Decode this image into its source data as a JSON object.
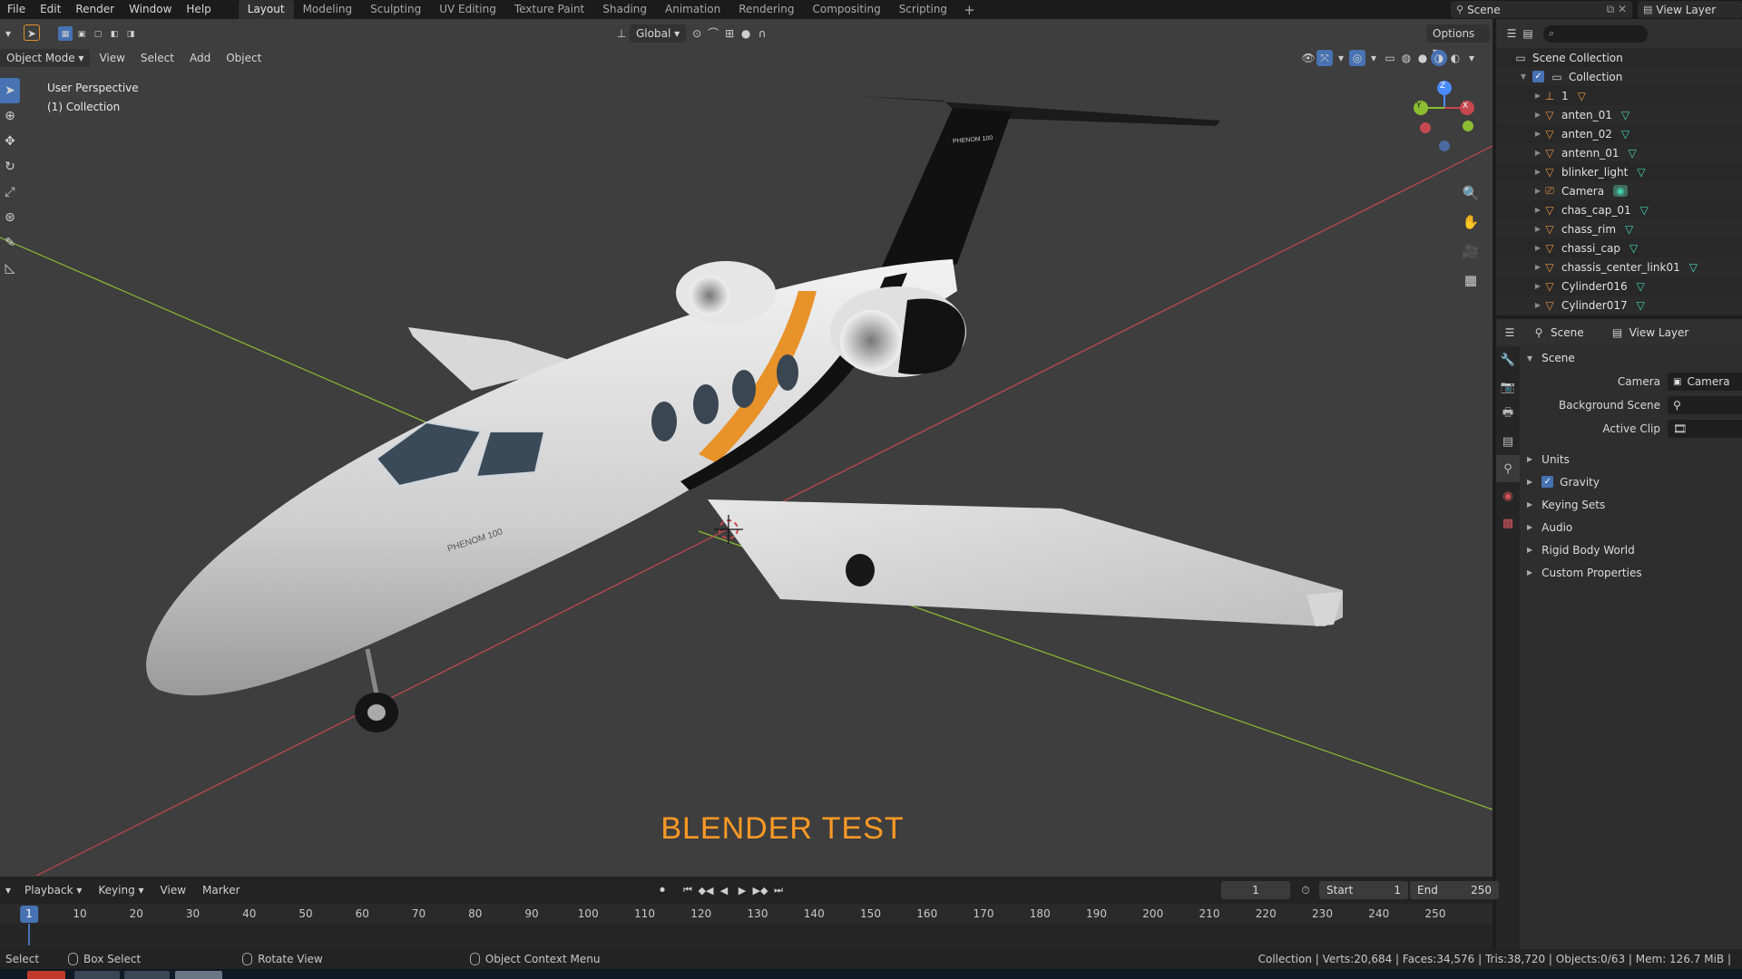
{
  "menubar": {
    "items": [
      "File",
      "Edit",
      "Render",
      "Window",
      "Help"
    ],
    "workspaces": [
      "Layout",
      "Modeling",
      "Sculpting",
      "UV Editing",
      "Texture Paint",
      "Shading",
      "Animation",
      "Rendering",
      "Compositing",
      "Scripting"
    ],
    "active_workspace": "Layout",
    "add_workspace": "+",
    "scene_name": "Scene",
    "view_layer_name": "View Layer"
  },
  "viewport": {
    "mode": "Object Mode",
    "menus": [
      "View",
      "Select",
      "Add",
      "Object"
    ],
    "transform_orientation": "Global",
    "options_label": "Options",
    "info_line1": "User Perspective",
    "info_line2": "(1) Collection",
    "overlay_text": "BLENDER TEST",
    "aircraft_text": "PHENOM 100",
    "tail_text": "PHENOM 100",
    "gizmo_axes": {
      "x": "X",
      "y": "Y",
      "z": "Z"
    },
    "colors": {
      "background": "#3e3e3e",
      "x_axis": "#c6484f",
      "y_axis": "#8bbd32",
      "overlay_text": "#ff9a25",
      "accent": "#4772b3"
    }
  },
  "outliner": {
    "root": "Scene Collection",
    "collection": "Collection",
    "items": [
      {
        "name": "1",
        "icon": "empty-icon"
      },
      {
        "name": "anten_01",
        "icon": "mesh-icon"
      },
      {
        "name": "anten_02",
        "icon": "mesh-icon"
      },
      {
        "name": "antenn_01",
        "icon": "mesh-icon"
      },
      {
        "name": "blinker_light",
        "icon": "mesh-icon"
      },
      {
        "name": "Camera",
        "icon": "camera-icon"
      },
      {
        "name": "chas_cap_01",
        "icon": "mesh-icon"
      },
      {
        "name": "chass_rim",
        "icon": "mesh-icon"
      },
      {
        "name": "chassi_cap",
        "icon": "mesh-icon"
      },
      {
        "name": "chassis_center_link01",
        "icon": "mesh-icon"
      },
      {
        "name": "Cylinder016",
        "icon": "mesh-icon"
      },
      {
        "name": "Cylinder017",
        "icon": "mesh-icon"
      }
    ]
  },
  "properties": {
    "header_scene": "Scene",
    "header_view_layer": "View Layer",
    "panel_title": "Scene",
    "camera_label": "Camera",
    "camera_value": "Camera",
    "background_scene_label": "Background Scene",
    "active_clip_label": "Active Clip",
    "subpanels": [
      "Units",
      "Gravity",
      "Keying Sets",
      "Audio",
      "Rigid Body World",
      "Custom Properties"
    ],
    "gravity_checked": true
  },
  "timeline": {
    "menus": [
      "Playback",
      "Keying",
      "View",
      "Marker"
    ],
    "current_frame": "1",
    "start_label": "Start",
    "start_value": "1",
    "end_label": "End",
    "end_value": "250",
    "ruler_labels": [
      "1",
      "10",
      "20",
      "30",
      "40",
      "50",
      "60",
      "70",
      "80",
      "90",
      "100",
      "110",
      "120",
      "130",
      "140",
      "150",
      "160",
      "170",
      "180",
      "190",
      "200",
      "210",
      "220",
      "230",
      "240",
      "250"
    ]
  },
  "statusbar": {
    "select": "Select",
    "box_select": "Box Select",
    "rotate_view": "Rotate View",
    "context_menu": "Object Context Menu",
    "stats": "Collection | Verts:20,684 | Faces:34,576 | Tris:38,720 | Objects:0/63 | Mem: 126.7 MiB |"
  }
}
